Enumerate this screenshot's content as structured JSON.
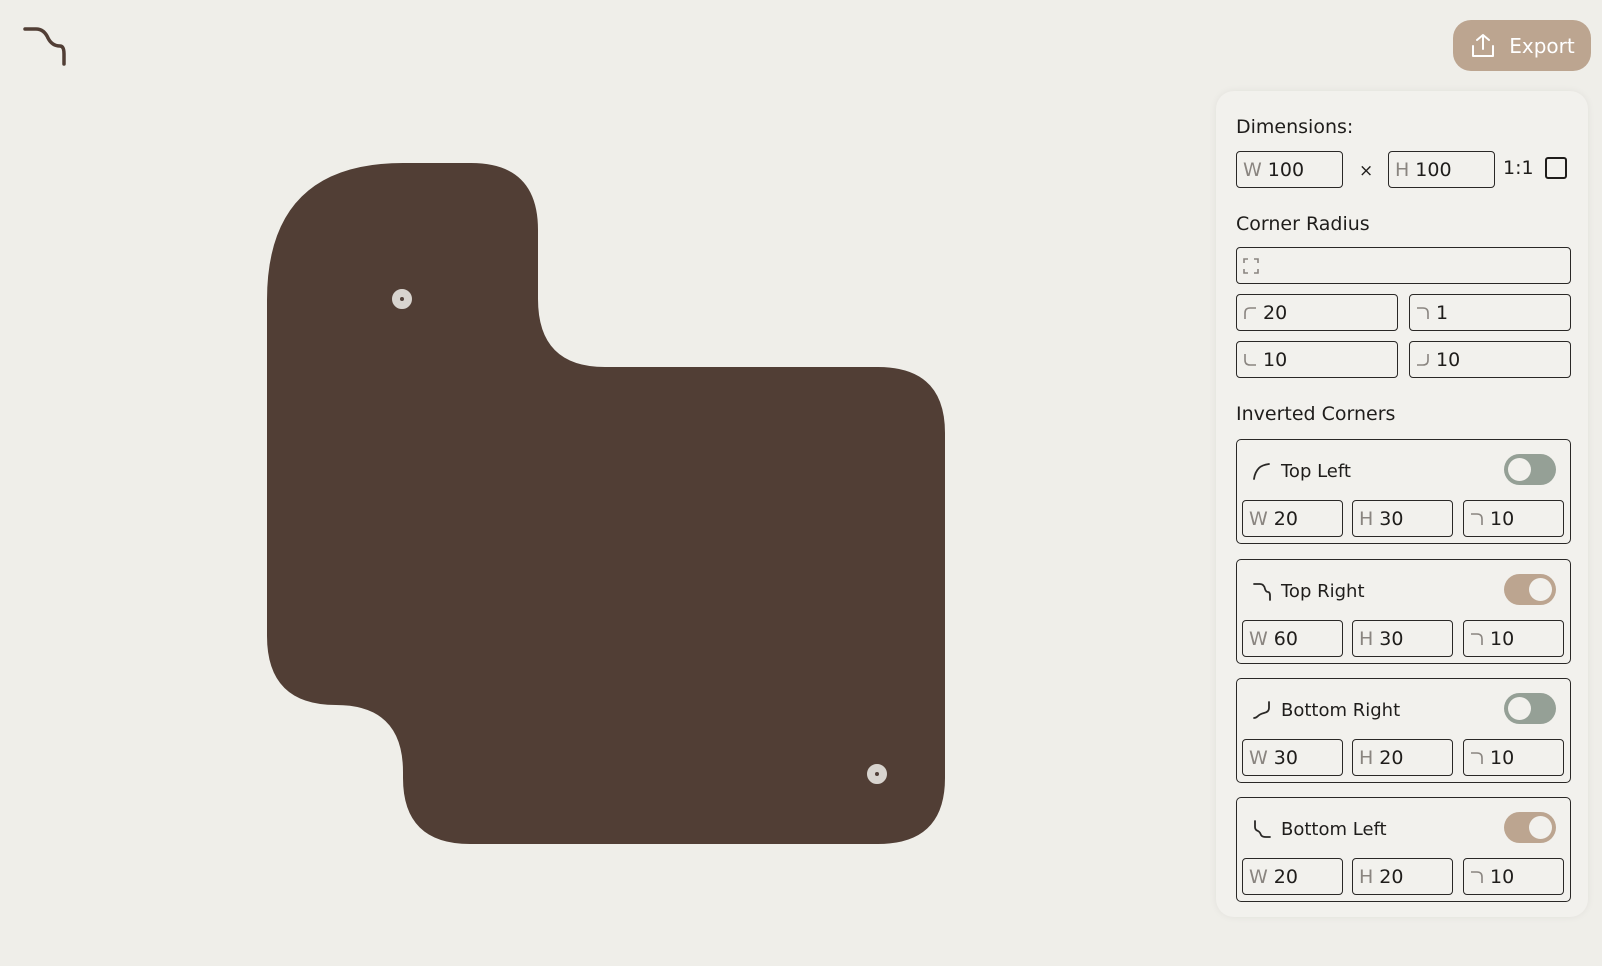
{
  "app": {
    "logo_icon": "wave-corner-icon",
    "export_label": "Export",
    "export_icon": "upload-icon"
  },
  "colors": {
    "shape_fill": "#513e35",
    "background": "#efeee9",
    "accent": "#bca590",
    "toggle_off": "#95a096"
  },
  "dimensions": {
    "title": "Dimensions:",
    "w_prefix": "W",
    "w_value": "100",
    "times": "×",
    "h_prefix": "H",
    "h_value": "100",
    "ratio_label": "1:1",
    "ratio_locked": false
  },
  "corner_radius": {
    "title": "Corner Radius",
    "all_icon": "expand-corners-icon",
    "all_value": "",
    "top_left": "20",
    "top_right": "1",
    "bottom_left": "10",
    "bottom_right": "10"
  },
  "inverted": {
    "title": "Inverted Corners",
    "corners": [
      {
        "label": "Top Left",
        "enabled": false,
        "w_prefix": "W",
        "w": "20",
        "h_prefix": "H",
        "h": "30",
        "r": "10"
      },
      {
        "label": "Top Right",
        "enabled": true,
        "w_prefix": "W",
        "w": "60",
        "h_prefix": "H",
        "h": "30",
        "r": "10"
      },
      {
        "label": "Bottom Right",
        "enabled": false,
        "w_prefix": "W",
        "w": "30",
        "h_prefix": "H",
        "h": "20",
        "r": "10"
      },
      {
        "label": "Bottom Left",
        "enabled": true,
        "w_prefix": "W",
        "w": "20",
        "h_prefix": "H",
        "h": "20",
        "r": "10"
      }
    ]
  }
}
